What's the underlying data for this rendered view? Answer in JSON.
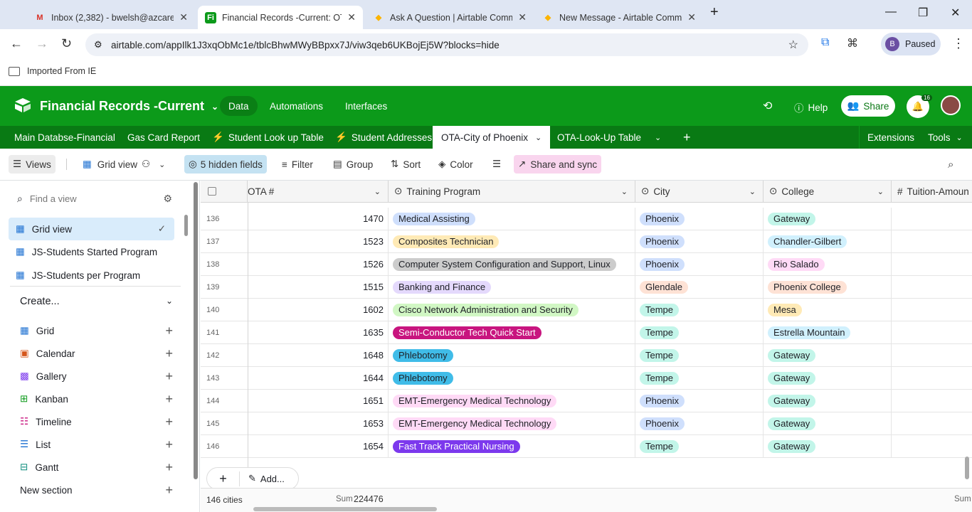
{
  "browser": {
    "tabs": [
      {
        "title": "Inbox (2,382) - bwelsh@azcare",
        "icon": "gmail-icon"
      },
      {
        "title": "Financial Records -Current: OTA",
        "icon": "airtable-fi-icon"
      },
      {
        "title": "Ask A Question | Airtable Comm",
        "icon": "airtable-icon"
      },
      {
        "title": "New Message - Airtable Comm",
        "icon": "airtable-icon"
      }
    ],
    "url": "airtable.com/appIlk1J3xqObMc1e/tblcBhwMWyBBpxx7J/viw3qeb6UKBojEj5W?blocks=hide",
    "profile_letter": "B",
    "profile_status": "Paused",
    "bookmark": "Imported From IE"
  },
  "app": {
    "base_name": "Financial Records -Current",
    "nav": [
      "Data",
      "Automations",
      "Interfaces"
    ],
    "help": "Help",
    "share": "Share",
    "notif_count": "16"
  },
  "tables": [
    "Main Databse-Financial",
    "Gas Card Report",
    "Student Look up Table",
    "Student Addresses",
    "OTA-City of Phoenix",
    "OTA-Look-Up Table"
  ],
  "table_tools": {
    "extensions": "Extensions",
    "tools": "Tools"
  },
  "toolbar": {
    "views": "Views",
    "grid_view": "Grid view",
    "hidden": "5 hidden fields",
    "filter": "Filter",
    "group": "Group",
    "sort": "Sort",
    "color": "Color",
    "share_sync": "Share and sync"
  },
  "sidebar": {
    "find_placeholder": "Find a view",
    "views": [
      "Grid view",
      "JS-Students Started Program",
      "JS-Students per Program"
    ],
    "create": "Create...",
    "create_items": [
      "Grid",
      "Calendar",
      "Gallery",
      "Kanban",
      "Timeline",
      "List",
      "Gantt"
    ],
    "new_section": "New section"
  },
  "grid": {
    "columns": [
      "OTA #",
      "Training Program",
      "City",
      "College",
      "Tuition-Amoun"
    ],
    "rows": [
      {
        "n": "136",
        "ota": "1470",
        "program": "Medical Assisting",
        "pcolor": "#cfdffc",
        "city": "Phoenix",
        "ccolor": "#cfdffc",
        "college": "Gateway",
        "kcolor": "#c2f5e9"
      },
      {
        "n": "137",
        "ota": "1523",
        "program": "Composites Technician",
        "pcolor": "#ffeab6",
        "city": "Phoenix",
        "ccolor": "#cfdffc",
        "college": "Chandler-Gilbert",
        "kcolor": "#d0f0fd"
      },
      {
        "n": "138",
        "ota": "1526",
        "program": "Computer System Configuration and Support, Linux",
        "pcolor": "#cccccc",
        "city": "Phoenix",
        "ccolor": "#cfdffc",
        "college": "Rio Salado",
        "kcolor": "#ffdaf6"
      },
      {
        "n": "139",
        "ota": "1515",
        "program": "Banking and Finance",
        "pcolor": "#e4d9fc",
        "city": "Glendale",
        "ccolor": "#fee2d5",
        "college": "Phoenix College",
        "kcolor": "#fee2d5"
      },
      {
        "n": "140",
        "ota": "1602",
        "program": "Cisco Network Administration and Security",
        "pcolor": "#d1f7c4",
        "city": "Tempe",
        "ccolor": "#c2f5e9",
        "college": "Mesa",
        "kcolor": "#ffeab6"
      },
      {
        "n": "141",
        "ota": "1635",
        "program": "Semi-Conductor Tech Quick Start",
        "pcolor": "#c8157f",
        "white": true,
        "city": "Tempe",
        "ccolor": "#c2f5e9",
        "college": "Estrella Mountain",
        "kcolor": "#d0f0fd"
      },
      {
        "n": "142",
        "ota": "1648",
        "program": "Phlebotomy",
        "pcolor": "#40bce8",
        "city": "Tempe",
        "ccolor": "#c2f5e9",
        "college": "Gateway",
        "kcolor": "#c2f5e9"
      },
      {
        "n": "143",
        "ota": "1644",
        "program": "Phlebotomy",
        "pcolor": "#40bce8",
        "city": "Tempe",
        "ccolor": "#c2f5e9",
        "college": "Gateway",
        "kcolor": "#c2f5e9"
      },
      {
        "n": "144",
        "ota": "1651",
        "program": "EMT-Emergency Medical Technology",
        "pcolor": "#ffdaf6",
        "city": "Phoenix",
        "ccolor": "#cfdffc",
        "college": "Gateway",
        "kcolor": "#c2f5e9"
      },
      {
        "n": "145",
        "ota": "1653",
        "program": "EMT-Emergency Medical Technology",
        "pcolor": "#ffdaf6",
        "city": "Phoenix",
        "ccolor": "#cfdffc",
        "college": "Gateway",
        "kcolor": "#c2f5e9"
      },
      {
        "n": "146",
        "ota": "1654",
        "program": "Fast Track Practical Nursing",
        "pcolor": "#7c39ed",
        "white": true,
        "city": "Tempe",
        "ccolor": "#c2f5e9",
        "college": "Gateway",
        "kcolor": "#c2f5e9"
      }
    ],
    "add_label": "Add...",
    "footer_count": "146 cities",
    "sum_label": "Sum",
    "sum_value": "224476"
  },
  "colors": {
    "brand_green": "#0c9a1a",
    "tab_green": "#097a14"
  }
}
